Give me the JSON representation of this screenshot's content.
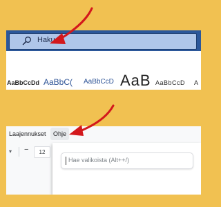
{
  "top": {
    "search_text": "Haku",
    "styles": [
      "AaBbCcDd",
      "AaBbC(",
      "AaBbCcD",
      "AaB",
      "AaBbCcD",
      "A"
    ]
  },
  "bottom": {
    "menu": {
      "extensions": "Laajennukset",
      "help": "Ohje"
    },
    "toolbar": {
      "minus": "−",
      "font_size": "12"
    },
    "dropdown": {
      "search_placeholder": "Hae valikoista (Alt++/)"
    }
  },
  "colors": {
    "background": "#f1c151",
    "title_bar": "#2b579a",
    "search_box": "#afc6e9",
    "arrow": "#d3181c"
  }
}
